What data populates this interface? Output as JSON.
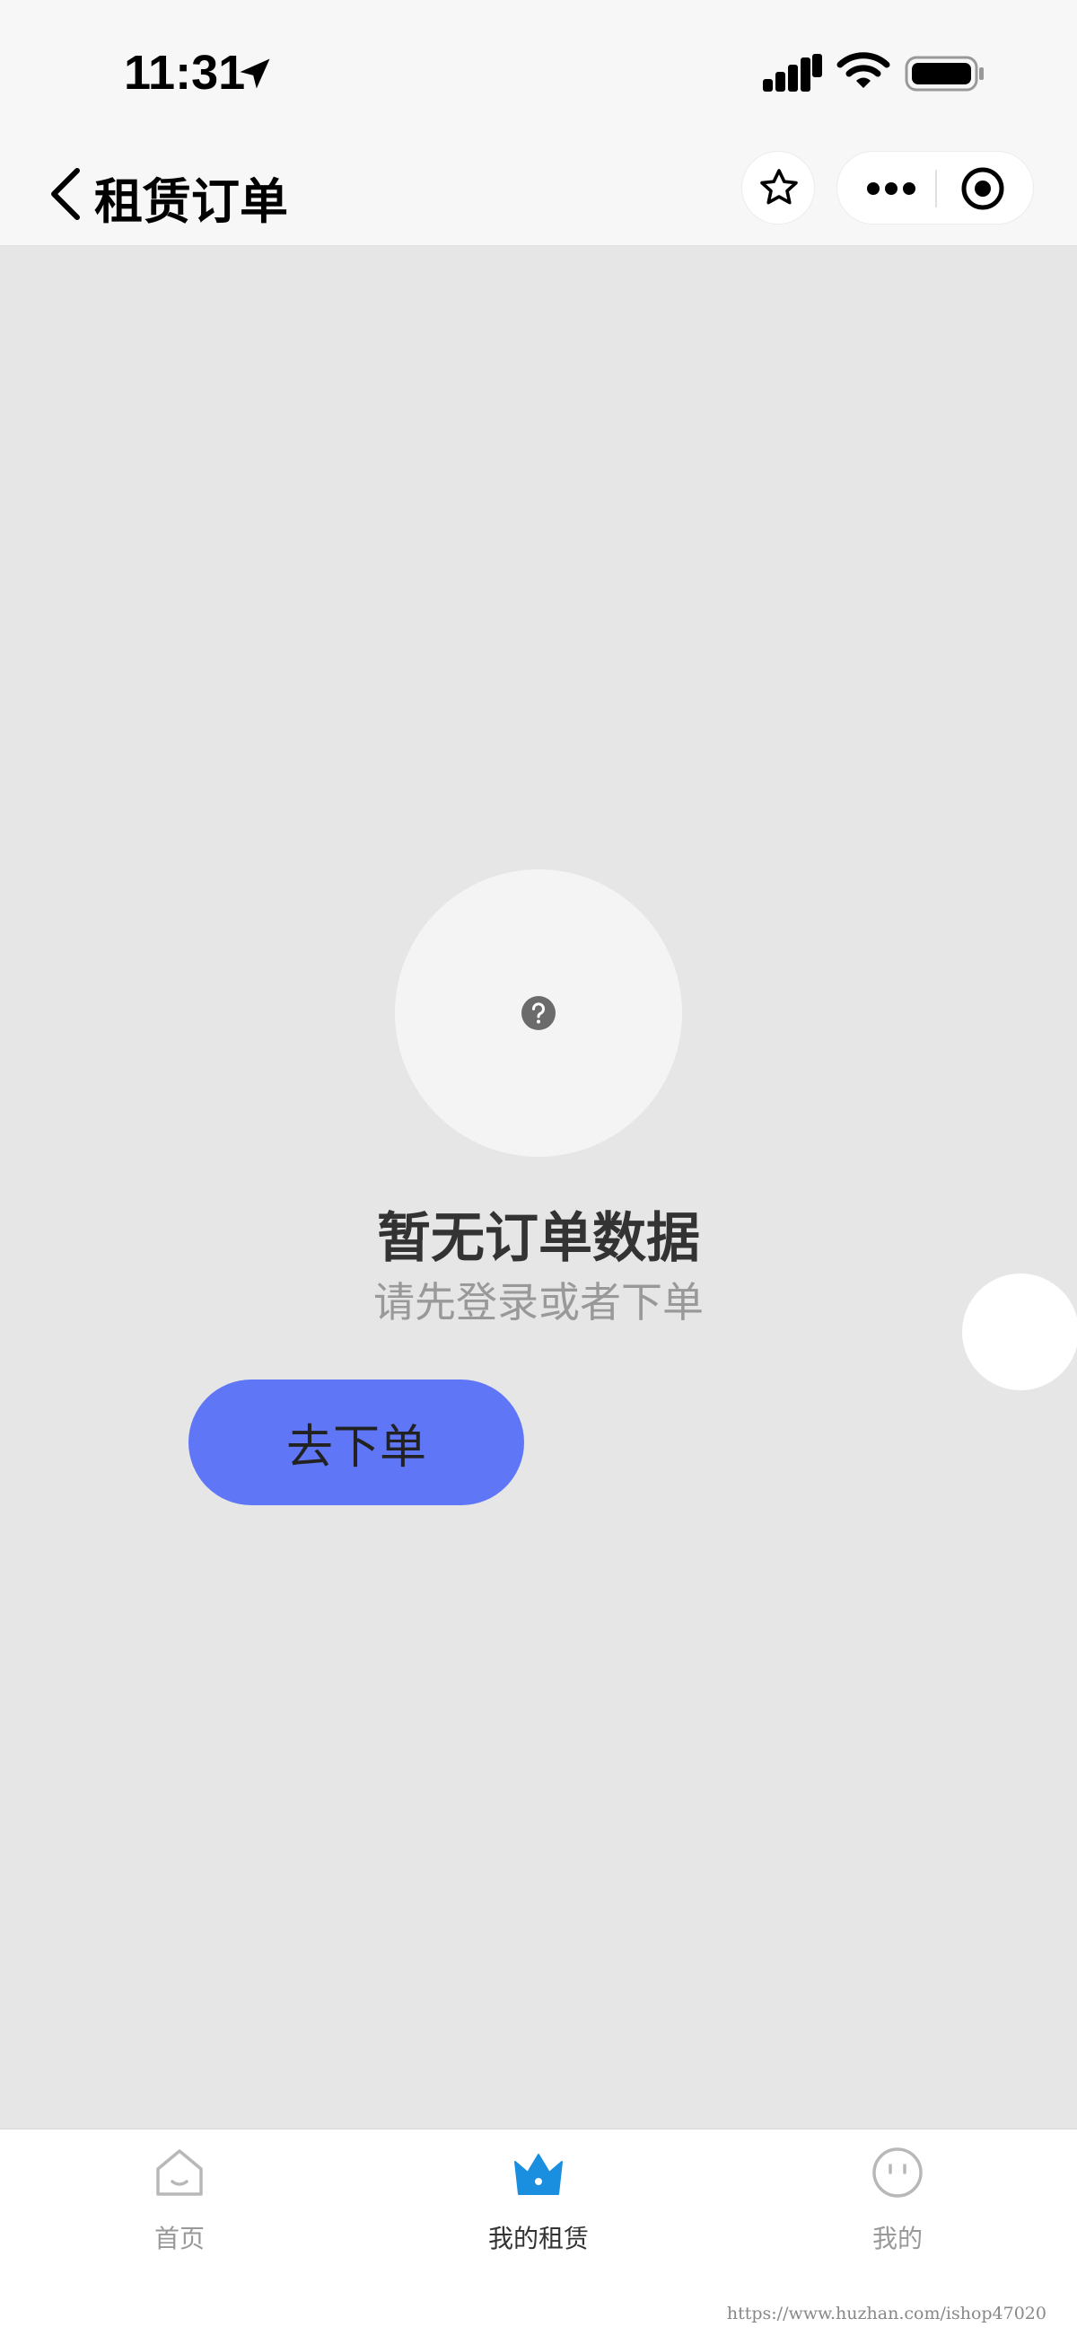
{
  "status_bar": {
    "time": "11:31"
  },
  "nav": {
    "title": "租赁订单"
  },
  "empty_state": {
    "title": "暂无订单数据",
    "subtitle": "请先登录或者下单",
    "button_label": "去下单"
  },
  "tab_bar": {
    "items": [
      {
        "label": "首页",
        "icon": "home-icon",
        "active": false
      },
      {
        "label": "我的租赁",
        "icon": "crown-icon",
        "active": true
      },
      {
        "label": "我的",
        "icon": "smiley-icon",
        "active": false
      }
    ],
    "active_color": "#1a8fe0"
  },
  "watermark": "https://www.huzhan.com/ishop47020",
  "colors": {
    "primary_button": "#5f76f7",
    "background": "#e6e6e6"
  }
}
